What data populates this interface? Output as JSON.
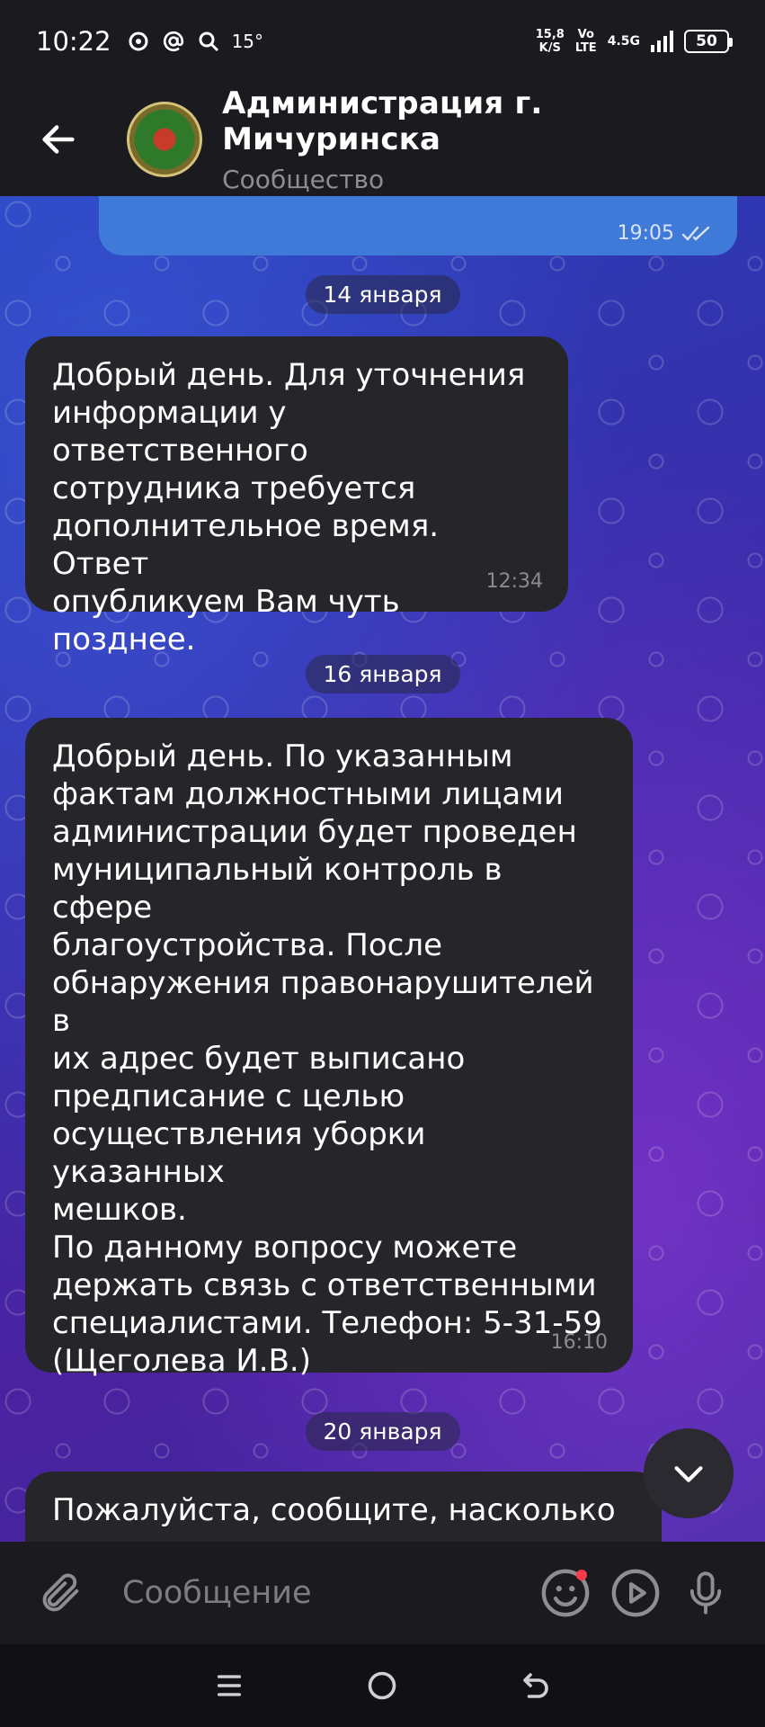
{
  "status_bar": {
    "time": "10:22",
    "temperature": "15°",
    "speed_value": "15,8",
    "speed_unit": "K/S",
    "volte_top": "Vo",
    "volte_bottom": "LTE",
    "network": "4.5G",
    "battery": "50"
  },
  "header": {
    "title": "Администрация г. Мичуринска",
    "subtitle": "Сообщество"
  },
  "chat": {
    "outgoing_time": "19:05",
    "groups": [
      {
        "date": "14 января",
        "message": "Добрый день. Для уточнения\nинформации у ответственного\nсотрудника требуется\nдополнительное время. Ответ\nопубликуем Вам чуть позднее.",
        "time": "12:34"
      },
      {
        "date": "16 января",
        "message": "Добрый день. По указанным\nфактам должностными лицами\nадминистрации будет проведен\nмуниципальный контроль в сфере\nблагоустройства. После\nобнаружения правонарушителей в\nих адрес будет выписано\nпредписание с целью\nосуществления уборки указанных\nмешков.\nПо данному вопросу можете\nдержать связь с ответственными\nспециалистами. Телефон: 5-31-59\n(Щеголева И.В.)",
        "time": "16:10"
      },
      {
        "date": "20 января",
        "message": "Пожалуйста, сообщите, насколько",
        "time": ""
      }
    ]
  },
  "input": {
    "placeholder": "Сообщение"
  },
  "icons": {
    "back": "arrow-left-icon",
    "attach": "paperclip-icon",
    "emoji": "smile-icon",
    "video_message": "play-circle-icon",
    "voice": "microphone-icon",
    "scroll_down": "chevron-down-icon"
  },
  "colors": {
    "outgoing_bubble": "#3f7ad8",
    "incoming_bubble": "#26262a",
    "bar_background": "#1b1b1f",
    "notification_dot": "#ff3b4a"
  }
}
